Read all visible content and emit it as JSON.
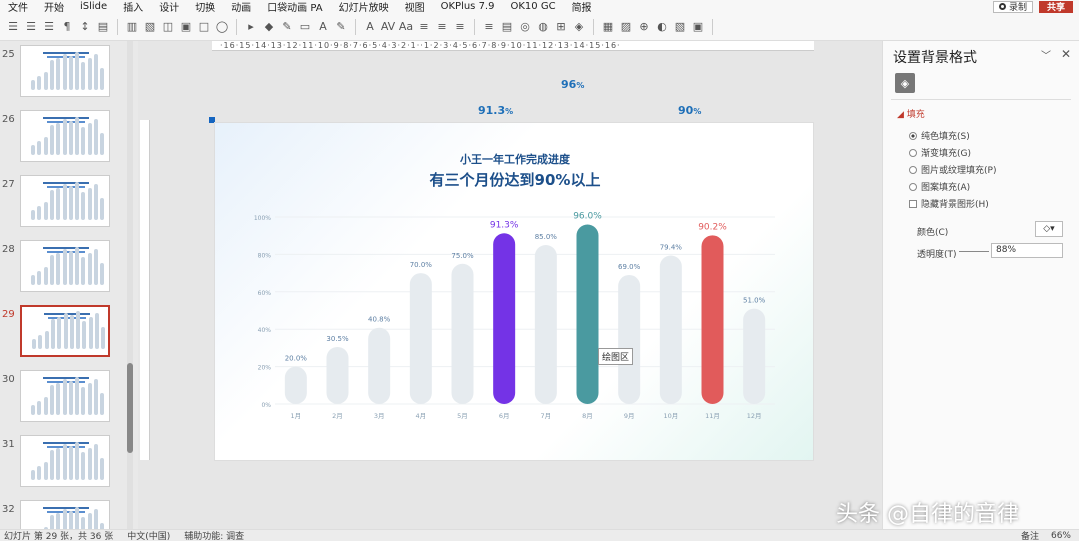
{
  "menu": [
    "文件",
    "开始",
    "iSlide",
    "插入",
    "设计",
    "切换",
    "动画",
    "口袋动画 PA",
    "幻灯片放映",
    "视图",
    "OKPlus 7.9",
    "OK10 GC",
    "简报"
  ],
  "menu_right": {
    "record": "录制",
    "share": "共享"
  },
  "ruler_text": "·16·15·14·13·12·11·10·9·8·7·6·5·4·3·2·1··1·2·3·4·5·6·7·8·9·10·11·12·13·14·15·16·",
  "thumbnails": [
    {
      "num": "25",
      "active": false
    },
    {
      "num": "26",
      "active": false
    },
    {
      "num": "27",
      "active": false
    },
    {
      "num": "28",
      "active": false
    },
    {
      "num": "29",
      "active": true
    },
    {
      "num": "30",
      "active": false
    },
    {
      "num": "31",
      "active": false
    },
    {
      "num": "32",
      "active": false
    }
  ],
  "floating_labels": [
    {
      "value": "91.3",
      "unit": "%"
    },
    {
      "value": "96",
      "unit": "%"
    },
    {
      "value": "90",
      "unit": "%"
    }
  ],
  "slide": {
    "subtitle": "小王一年工作完成进度",
    "title": "有三个月份达到90%以上"
  },
  "tooltip": "绘图区",
  "chart_data": {
    "type": "bar",
    "categories": [
      "1月",
      "2月",
      "3月",
      "4月",
      "5月",
      "6月",
      "7月",
      "8月",
      "9月",
      "10月",
      "11月",
      "12月"
    ],
    "values": [
      20.0,
      30.5,
      40.8,
      70.0,
      75.0,
      91.3,
      85.0,
      96.0,
      69.0,
      79.4,
      90.2,
      51.0
    ],
    "data_labels": [
      "20.0%",
      "30.5%",
      "40.8%",
      "70.0%",
      "75.0%",
      "91.3%",
      "85.0%",
      "96.0%",
      "69.0%",
      "79.4%",
      "90.2%",
      "51.0%"
    ],
    "highlight_colors": {
      "5": "#7433e6",
      "7": "#4a9aa0",
      "10": "#e15b5b"
    },
    "base_color": "#e6ebef",
    "yticks": [
      "0%",
      "20%",
      "40%",
      "60%",
      "80%",
      "100%"
    ],
    "ylim": [
      0,
      100
    ],
    "grid": true
  },
  "panel": {
    "title": "设置背景格式",
    "section": "填充",
    "options": [
      {
        "label": "纯色填充(S)",
        "type": "radio",
        "on": true
      },
      {
        "label": "渐变填充(G)",
        "type": "radio",
        "on": false
      },
      {
        "label": "图片或纹理填充(P)",
        "type": "radio",
        "on": false
      },
      {
        "label": "图案填充(A)",
        "type": "radio",
        "on": false
      },
      {
        "label": "隐藏背景图形(H)",
        "type": "check",
        "on": false
      }
    ],
    "color_label": "颜色(C)",
    "transparency_label": "透明度(T)",
    "transparency_value": "88%"
  },
  "status": {
    "slide_info": "幻灯片 第 29 张，共 36 张",
    "language": "中文(中国)",
    "accessibility": "辅助功能: 调查",
    "notes": "备注",
    "zoom": "66%"
  },
  "watermark": "头条 @自律的音律"
}
